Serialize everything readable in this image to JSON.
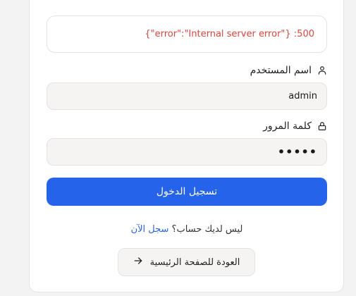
{
  "error": {
    "message": "{\"error\":\"Internal server error\"} :500",
    "color": "#e0443a"
  },
  "username": {
    "label": "اسم المستخدم",
    "value": "admin",
    "icon": "user-icon"
  },
  "password": {
    "label": "كلمة المرور",
    "value": "•••••",
    "icon": "lock-icon"
  },
  "login_button": {
    "label": "تسجيل الدخول",
    "color": "#2563eb"
  },
  "signup": {
    "prompt": "ليس لديك حساب؟",
    "link": "سجل الآن"
  },
  "home_button": {
    "label": "العودة للصفحة الرئيسية",
    "icon": "arrow-right-icon"
  }
}
